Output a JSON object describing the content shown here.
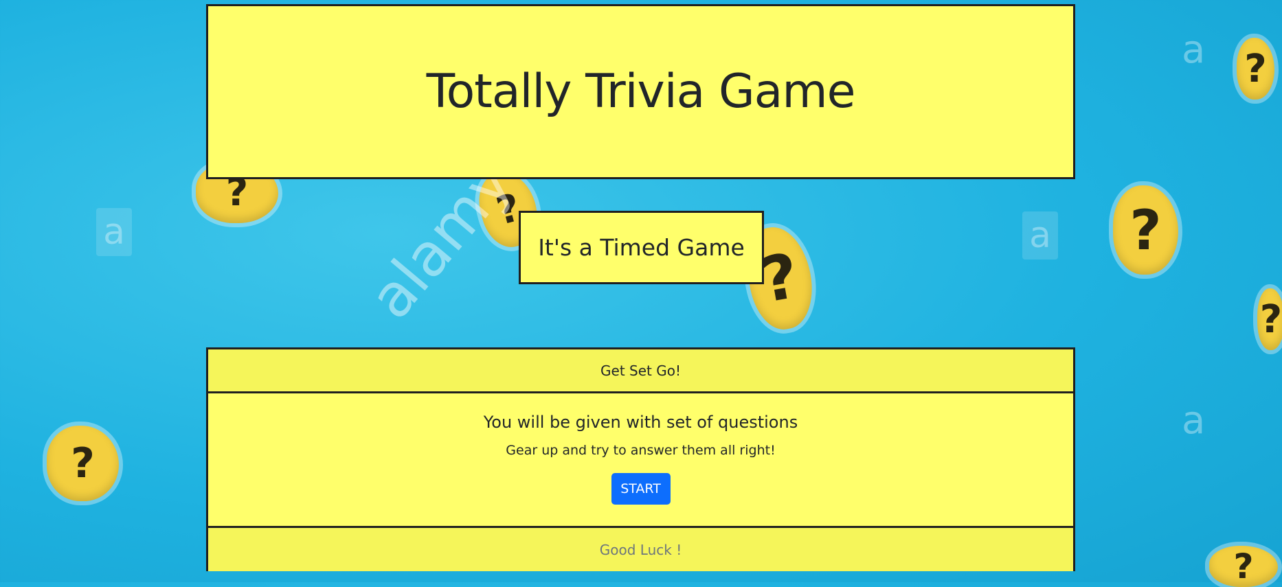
{
  "header": {
    "title": "Totally Trivia Game"
  },
  "subheader": {
    "text": "It's a Timed Game"
  },
  "card": {
    "header": "Get Set Go!",
    "title": "You will be given with set of questions",
    "text": "Gear up and try to answer them all right!",
    "button": "START",
    "footer": "Good Luck !"
  },
  "background": {
    "hole_mark": "?",
    "watermark_letter": "a",
    "watermark_word": "alamy"
  },
  "colors": {
    "panel": "#ffff6b",
    "accent_button": "#0d6efd",
    "background": "#1fb2e0"
  }
}
